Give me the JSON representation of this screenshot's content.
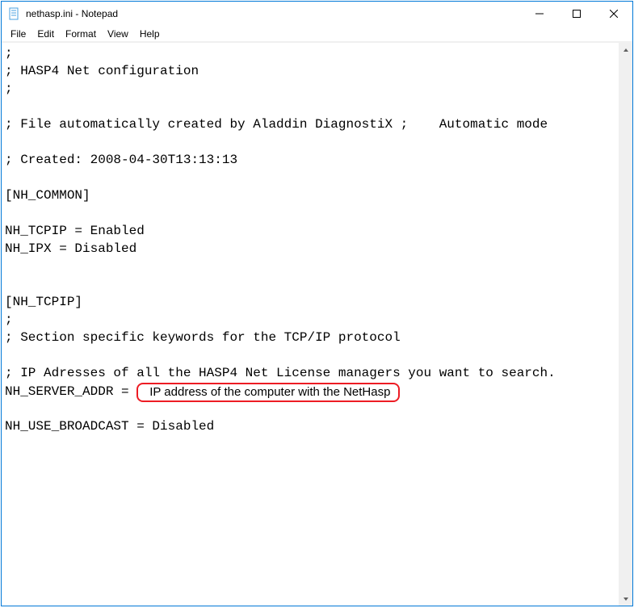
{
  "titlebar": {
    "title": "nethasp.ini - Notepad"
  },
  "menubar": {
    "file": "File",
    "edit": "Edit",
    "format": "Format",
    "view": "View",
    "help": "Help"
  },
  "content": {
    "l1": ";",
    "l2": "; HASP4 Net configuration",
    "l3": ";",
    "l4": "",
    "l5": "; File automatically created by Aladdin DiagnostiX ;    Automatic mode",
    "l6": "",
    "l7": "; Created: 2008-04-30T13:13:13",
    "l8": "",
    "l9": "[NH_COMMON]",
    "l10": "",
    "l11": "NH_TCPIP = Enabled",
    "l12": "NH_IPX = Disabled",
    "l13": "",
    "l14": "",
    "l15": "[NH_TCPIP]",
    "l16": ";",
    "l17": "; Section specific keywords for the TCP/IP protocol",
    "l18": "",
    "l19": "; IP Adresses of all the HASP4 Net License managers you want to search.",
    "l20a": "NH_SERVER_ADDR = ",
    "l20b": "IP address of the computer with the NetHasp",
    "l21": "",
    "l22": "NH_USE_BROADCAST = Disabled"
  }
}
